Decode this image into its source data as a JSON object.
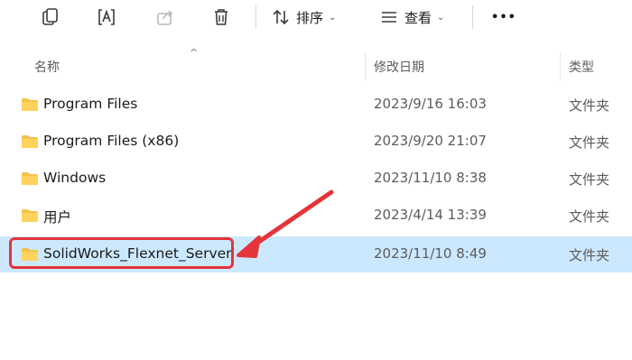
{
  "toolbar": {
    "copy_icon": "copy-icon",
    "rename_icon": "rename-icon",
    "share_icon": "share-icon",
    "delete_icon": "trash-icon",
    "sort_label": "排序",
    "view_label": "查看",
    "more_label": "•••"
  },
  "columns": {
    "name": "名称",
    "date": "修改日期",
    "type": "类型"
  },
  "rows": [
    {
      "name": "Program Files",
      "date": "2023/9/16 16:03",
      "type": "文件夹"
    },
    {
      "name": "Program Files (x86)",
      "date": "2023/9/20 21:07",
      "type": "文件夹"
    },
    {
      "name": "Windows",
      "date": "2023/11/10 8:38",
      "type": "文件夹"
    },
    {
      "name": "用户",
      "date": "2023/4/14 13:39",
      "type": "文件夹"
    },
    {
      "name": "SolidWorks_Flexnet_Server",
      "date": "2023/11/10 8:49",
      "type": "文件夹",
      "selected": true
    }
  ],
  "colors": {
    "selection": "#cce8ff",
    "annotation": "#e5343a",
    "folder": "#f4c24a"
  }
}
